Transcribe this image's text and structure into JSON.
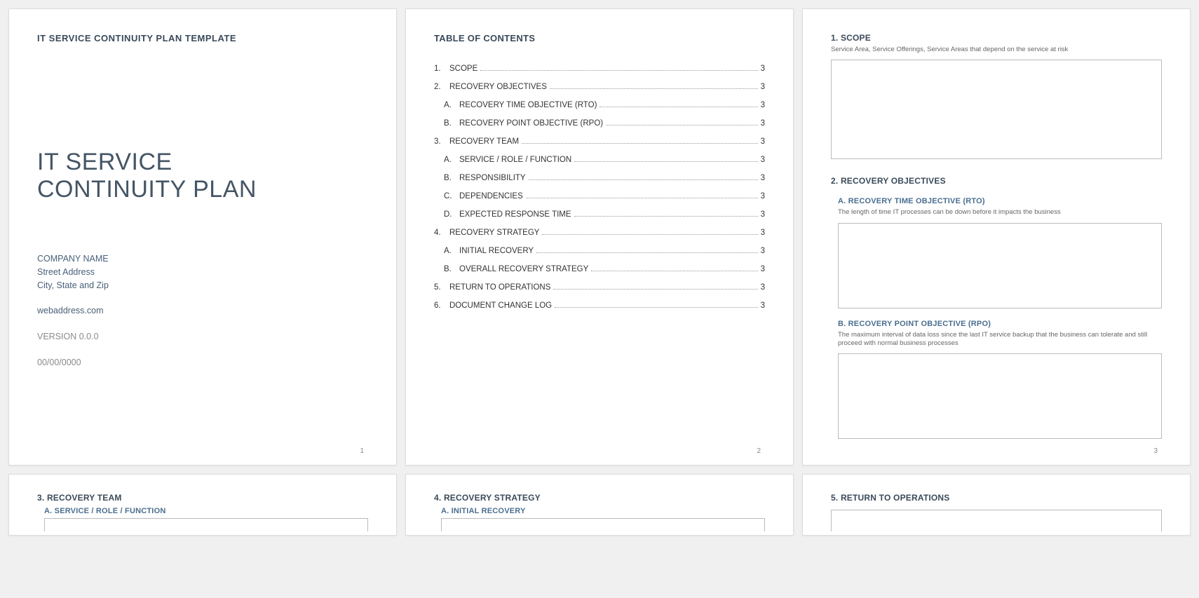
{
  "cover": {
    "template_label": "IT SERVICE CONTINUITY PLAN TEMPLATE",
    "title_line1": "IT SERVICE",
    "title_line2": "CONTINUITY PLAN",
    "company": "COMPANY NAME",
    "street": "Street Address",
    "city": "City, State and Zip",
    "web": "webaddress.com",
    "version": "VERSION 0.0.0",
    "date": "00/00/0000",
    "page_num": "1"
  },
  "toc": {
    "title": "TABLE OF CONTENTS",
    "page_num": "2",
    "items": [
      {
        "n": "1.",
        "label": "SCOPE",
        "p": "3",
        "sub": false
      },
      {
        "n": "2.",
        "label": "RECOVERY OBJECTIVES",
        "p": "3",
        "sub": false
      },
      {
        "n": "A.",
        "label": "RECOVERY TIME OBJECTIVE (RTO)",
        "p": "3",
        "sub": true
      },
      {
        "n": "B.",
        "label": "RECOVERY POINT OBJECTIVE (RPO)",
        "p": "3",
        "sub": true
      },
      {
        "n": "3.",
        "label": "RECOVERY TEAM",
        "p": "3",
        "sub": false
      },
      {
        "n": "A.",
        "label": "SERVICE / ROLE / FUNCTION",
        "p": "3",
        "sub": true
      },
      {
        "n": "B.",
        "label": "RESPONSIBILITY",
        "p": "3",
        "sub": true
      },
      {
        "n": "C.",
        "label": "DEPENDENCIES",
        "p": "3",
        "sub": true
      },
      {
        "n": "D.",
        "label": "EXPECTED RESPONSE TIME",
        "p": "3",
        "sub": true
      },
      {
        "n": "4.",
        "label": "RECOVERY STRATEGY",
        "p": "3",
        "sub": false
      },
      {
        "n": "A.",
        "label": "INITIAL RECOVERY",
        "p": "3",
        "sub": true
      },
      {
        "n": "B.",
        "label": "OVERALL RECOVERY STRATEGY",
        "p": "3",
        "sub": true
      },
      {
        "n": "5.",
        "label": "RETURN TO OPERATIONS",
        "p": "3",
        "sub": false
      },
      {
        "n": "6.",
        "label": "DOCUMENT CHANGE LOG",
        "p": "3",
        "sub": false
      }
    ]
  },
  "page3": {
    "page_num": "3",
    "scope": {
      "title": "1.  SCOPE",
      "desc": "Service Area, Service Offerings, Service Areas that depend on the service at risk"
    },
    "recobj": {
      "title": "2.  RECOVERY OBJECTIVES",
      "rto_title": "A.  RECOVERY TIME OBJECTIVE (RTO)",
      "rto_desc": "The length of time IT processes can be down before it impacts the business",
      "rpo_title": "B.  RECOVERY POINT OBJECTIVE (RPO)",
      "rpo_desc": "The maximum interval of data loss since the last IT service backup that the business can tolerate and still proceed with normal business processes"
    }
  },
  "page4": {
    "title": "3.  RECOVERY TEAM",
    "sub": "A.  SERVICE / ROLE / FUNCTION"
  },
  "page5": {
    "title": "4.  RECOVERY STRATEGY",
    "sub": "A.  INITIAL RECOVERY"
  },
  "page6": {
    "title": "5.  RETURN TO OPERATIONS"
  }
}
